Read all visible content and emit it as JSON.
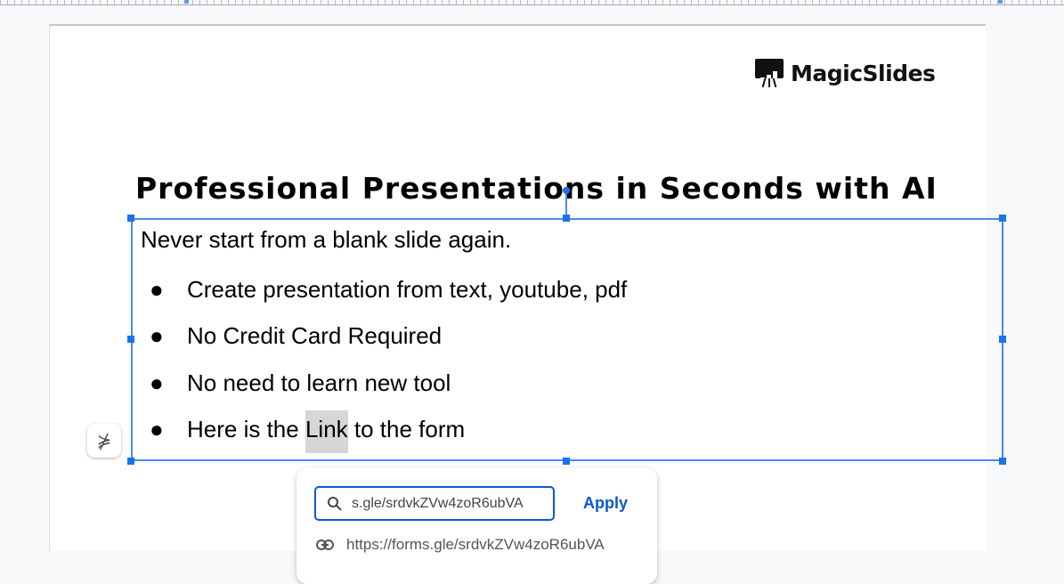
{
  "logo": {
    "text": "MagicSlides"
  },
  "slide": {
    "title": "Professional Presentations in Seconds with AI",
    "intro": "Never start from a blank slide again.",
    "bullets": [
      "Create presentation from text, youtube, pdf",
      "No Credit Card Required",
      "No need to learn new tool"
    ],
    "last_bullet": {
      "before": "Here is the ",
      "link": "Link",
      "after": " to the form"
    }
  },
  "link_popup": {
    "input_value": "s.gle/srdvkZVw4zoR6ubVA",
    "apply_label": "Apply",
    "suggestion": "https://forms.gle/srdvkZVw4zoR6ubVA"
  },
  "icons": {
    "search": "search-icon",
    "link": "link-icon",
    "format": "format-options-icon"
  },
  "colors": {
    "accent": "#1a73e8",
    "apply": "#0b57d0"
  }
}
